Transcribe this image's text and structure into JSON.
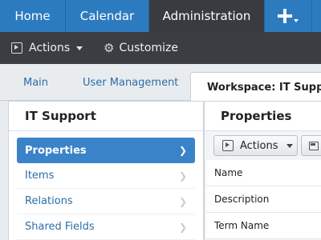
{
  "topnav": {
    "items": [
      {
        "label": "Home"
      },
      {
        "label": "Calendar"
      },
      {
        "label": "Administration"
      }
    ],
    "add_icon": "plus-icon"
  },
  "subbar": {
    "actions_label": "Actions",
    "customize_label": "Customize",
    "customize_icon": "gear-icon"
  },
  "tabs": [
    {
      "label": "Main"
    },
    {
      "label": "User Management"
    },
    {
      "label": "Workspace: IT Support"
    }
  ],
  "left_panel": {
    "title": "IT Support",
    "items": [
      {
        "label": "Properties",
        "active": true
      },
      {
        "label": "Items"
      },
      {
        "label": "Relations"
      },
      {
        "label": "Shared Fields"
      }
    ]
  },
  "right_panel": {
    "title": "Properties",
    "actions_label": "Actions",
    "fields": [
      {
        "label": "Name"
      },
      {
        "label": "Description"
      },
      {
        "label": "Term Name"
      }
    ]
  },
  "colors": {
    "nav_blue": "#2d7bbf",
    "nav_active": "#383c40",
    "toolbar_dark": "#3a3e42",
    "accent": "#3b83c8",
    "link": "#2d6da8"
  }
}
